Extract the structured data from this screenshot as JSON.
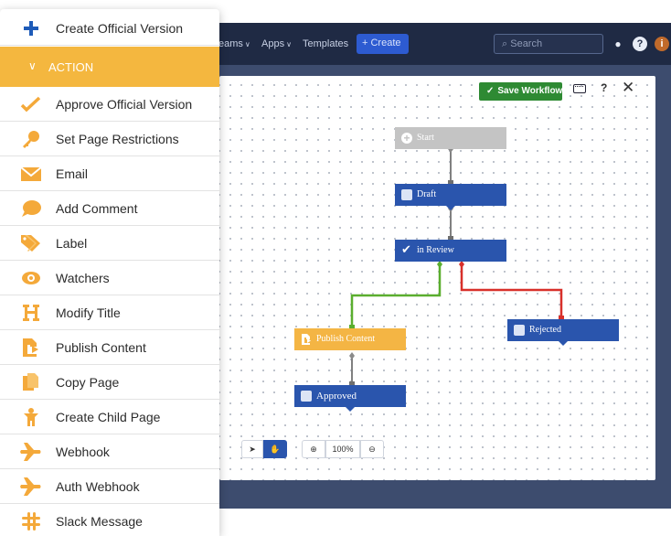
{
  "menu": {
    "top_item": {
      "label": "Create Official Version",
      "icon": "plus-icon"
    },
    "section_label": "ACTION",
    "items": [
      {
        "label": "Approve Official Version",
        "icon": "checkmark-icon"
      },
      {
        "label": "Set Page Restrictions",
        "icon": "key-icon"
      },
      {
        "label": "Email",
        "icon": "envelope-icon"
      },
      {
        "label": "Add Comment",
        "icon": "speech-bubble-icon"
      },
      {
        "label": "Label",
        "icon": "tag-icon"
      },
      {
        "label": "Watchers",
        "icon": "eye-icon"
      },
      {
        "label": "Modify Title",
        "icon": "heading-icon"
      },
      {
        "label": "Publish Content",
        "icon": "publish-document-icon"
      },
      {
        "label": "Copy Page",
        "icon": "copy-icon"
      },
      {
        "label": "Create Child Page",
        "icon": "child-person-icon"
      },
      {
        "label": "Webhook",
        "icon": "airplane-icon"
      },
      {
        "label": "Auth Webhook",
        "icon": "airplane-icon"
      },
      {
        "label": "Slack Message",
        "icon": "slack-icon"
      }
    ]
  },
  "topnav": {
    "teams_label": "eams",
    "apps_label": "Apps",
    "templates_label": "Templates",
    "create_label": "+ Create",
    "search_placeholder": "Search"
  },
  "editor": {
    "save_label": "Save Workflow",
    "help_label": "?",
    "close_label": "✕",
    "zoom_level": "100%"
  },
  "workflow": {
    "nodes": {
      "start": "Start",
      "draft": "Draft",
      "in_review": "in Review",
      "publish": "Publish Content",
      "rejected": "Rejected",
      "approved": "Approved"
    }
  },
  "colors": {
    "accent": "#f4b73f",
    "node_blue": "#2a55ad",
    "approve_line": "#5aae2e",
    "reject_line": "#d8302a",
    "save_green": "#2e8a33"
  }
}
